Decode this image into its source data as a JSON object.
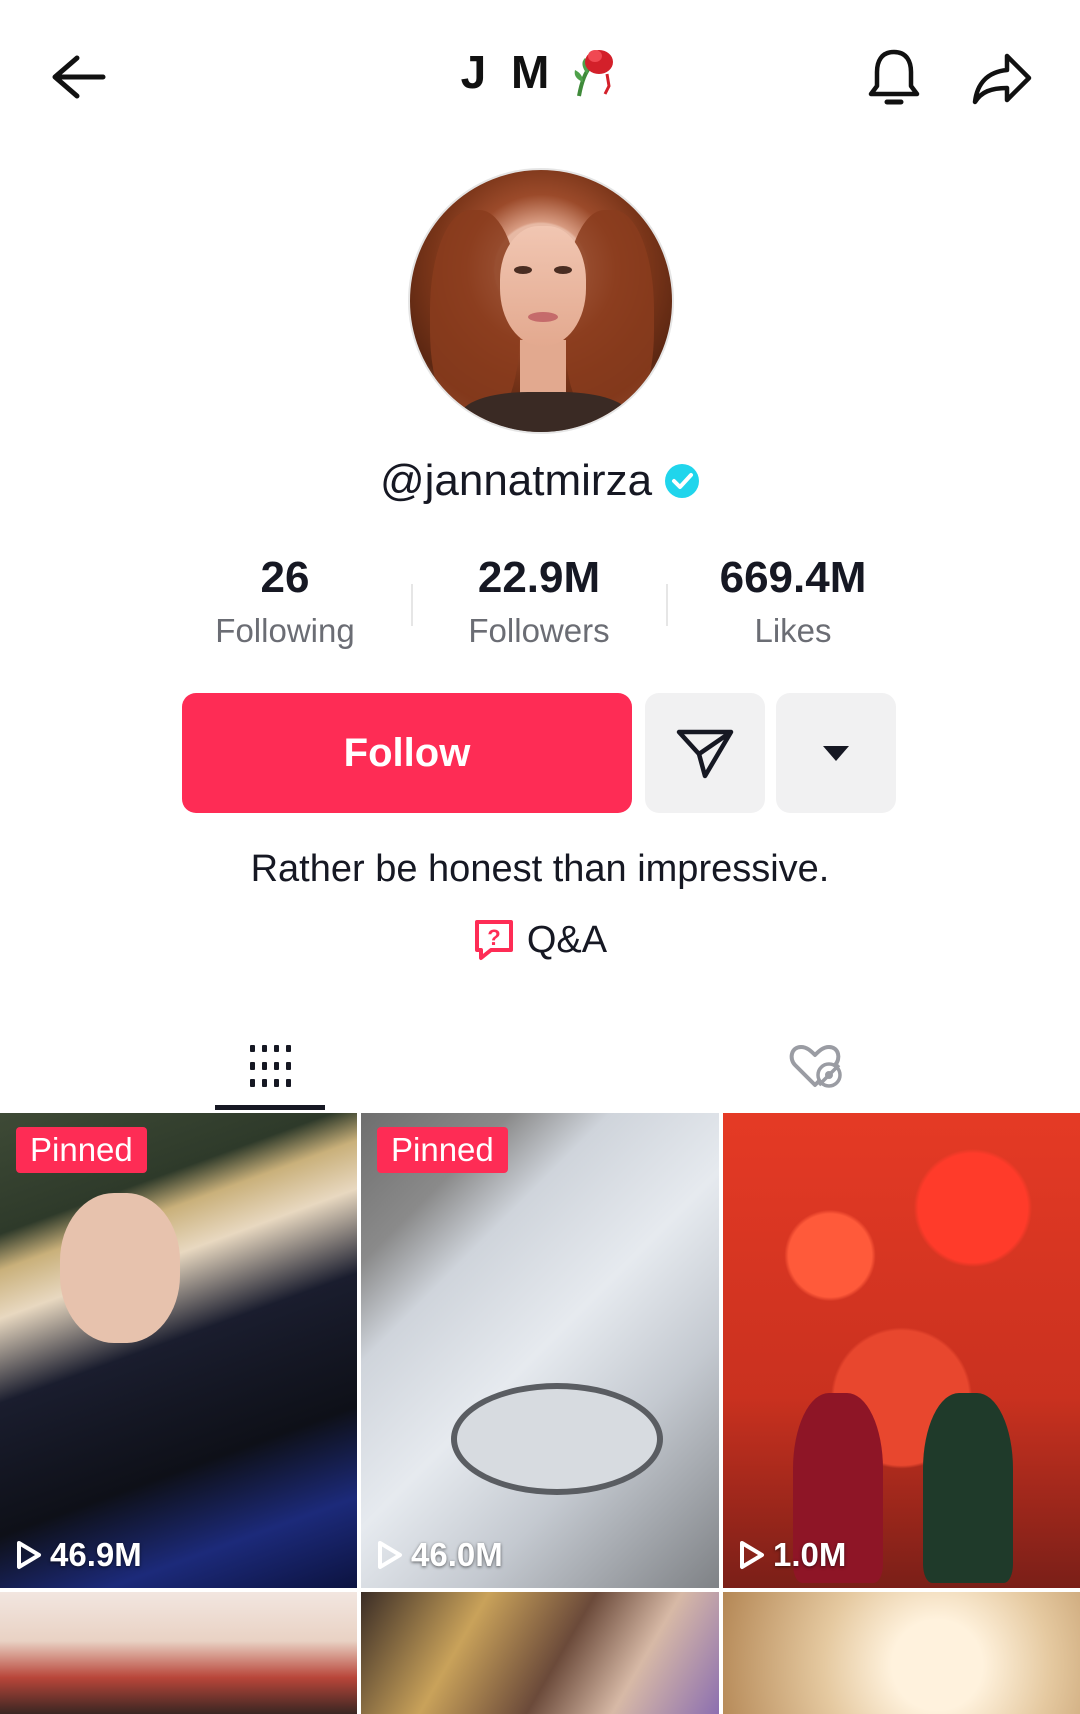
{
  "header": {
    "title": "J M",
    "title_icon": "wilted-rose-emoji",
    "back_icon": "arrow-left-icon",
    "bell_icon": "bell-icon",
    "share_icon": "share-arrow-icon"
  },
  "profile": {
    "username": "@jannatmirza",
    "verified": true,
    "verified_color": "#20d5ec",
    "bio": "Rather be honest than impressive.",
    "qa_label": "Q&A"
  },
  "stats": [
    {
      "value": "26",
      "label": "Following"
    },
    {
      "value": "22.9M",
      "label": "Followers"
    },
    {
      "value": "669.4M",
      "label": "Likes"
    }
  ],
  "actions": {
    "follow_label": "Follow",
    "follow_color": "#fe2c55",
    "message_icon": "send-icon",
    "more_icon": "triangle-down-icon"
  },
  "tabs": [
    {
      "icon": "videos-grid-icon",
      "active": true
    },
    {
      "icon": "liked-hidden-icon",
      "active": false
    }
  ],
  "videos": [
    {
      "pinned_label": "Pinned",
      "views": "46.9M"
    },
    {
      "pinned_label": "Pinned",
      "views": "46.0M"
    },
    {
      "views": "1.0M"
    }
  ]
}
